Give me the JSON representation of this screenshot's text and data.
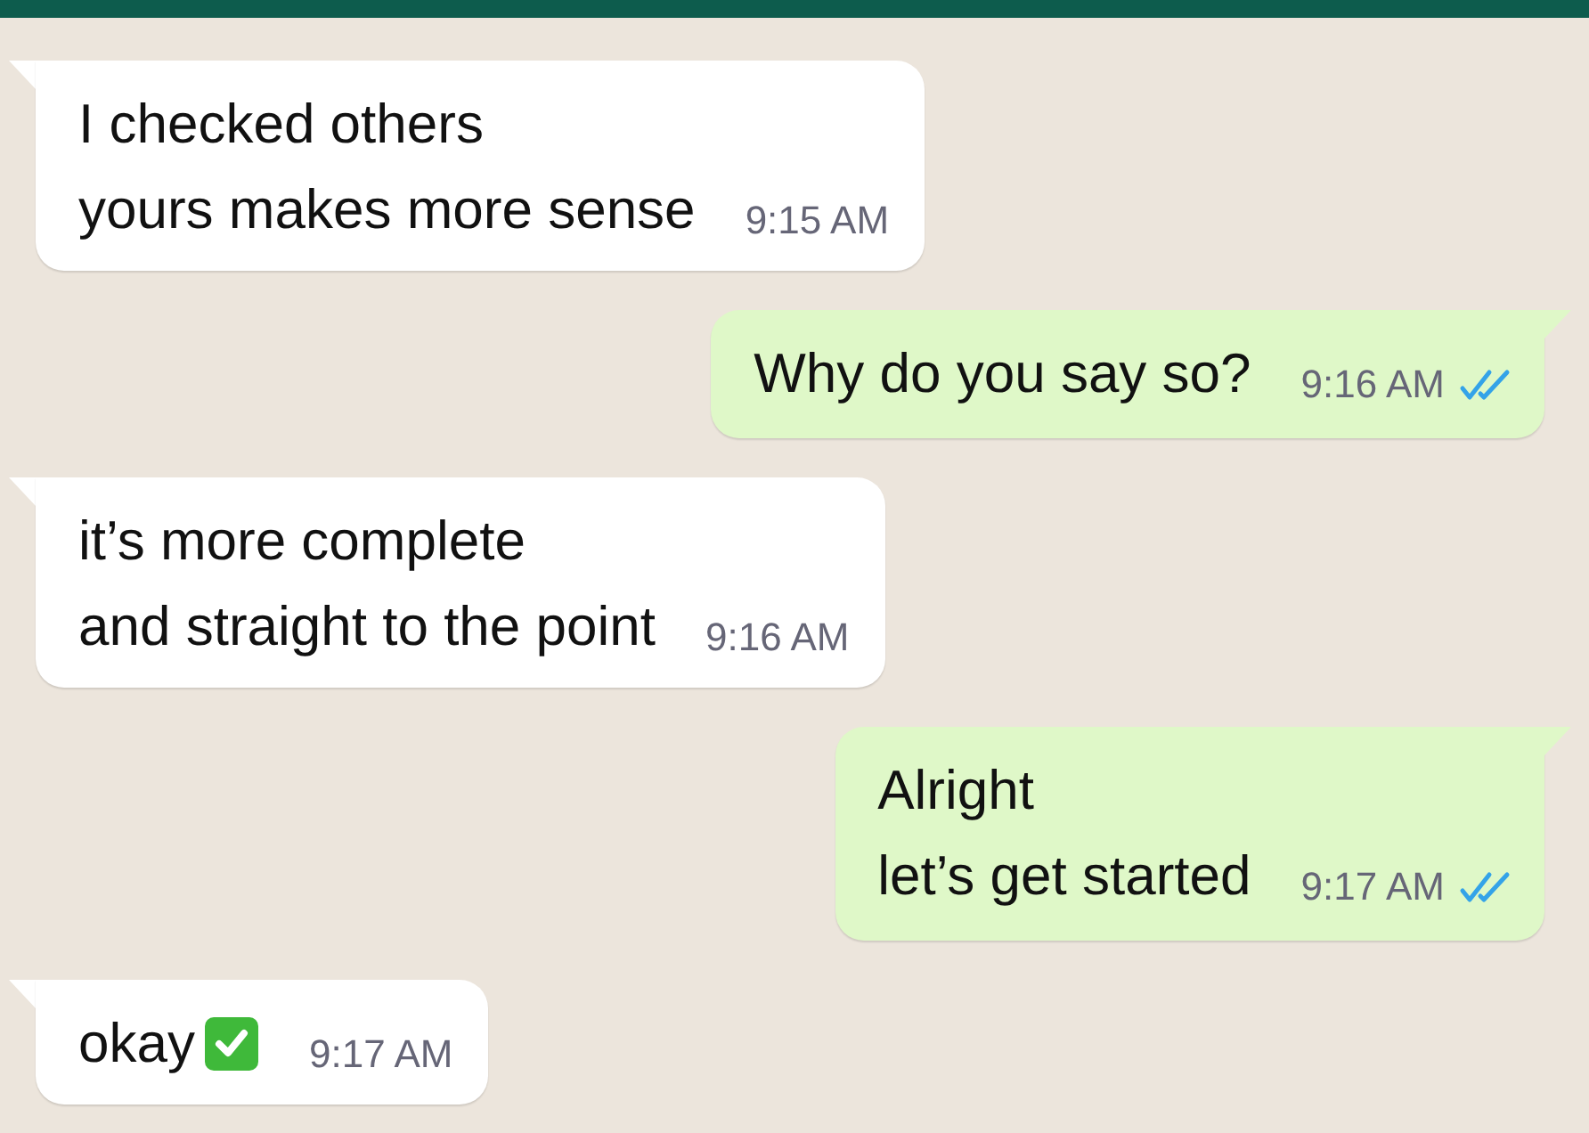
{
  "messages": [
    {
      "kind": "incoming",
      "lines": [
        "I checked others",
        "yours makes more sense"
      ],
      "time": "9:15 AM",
      "check_emoji": false
    },
    {
      "kind": "outgoing",
      "lines": [
        "Why do you say so?"
      ],
      "time": "9:16 AM",
      "read": true,
      "check_emoji": false
    },
    {
      "kind": "incoming",
      "lines": [
        "it’s more complete",
        "and straight to the point"
      ],
      "time": "9:16 AM",
      "check_emoji": false
    },
    {
      "kind": "outgoing",
      "lines": [
        "Alright",
        "let’s get started"
      ],
      "time": "9:17 AM",
      "read": true,
      "check_emoji": false
    },
    {
      "kind": "incoming",
      "lines": [
        "okay"
      ],
      "time": "9:17 AM",
      "check_emoji": true
    }
  ]
}
